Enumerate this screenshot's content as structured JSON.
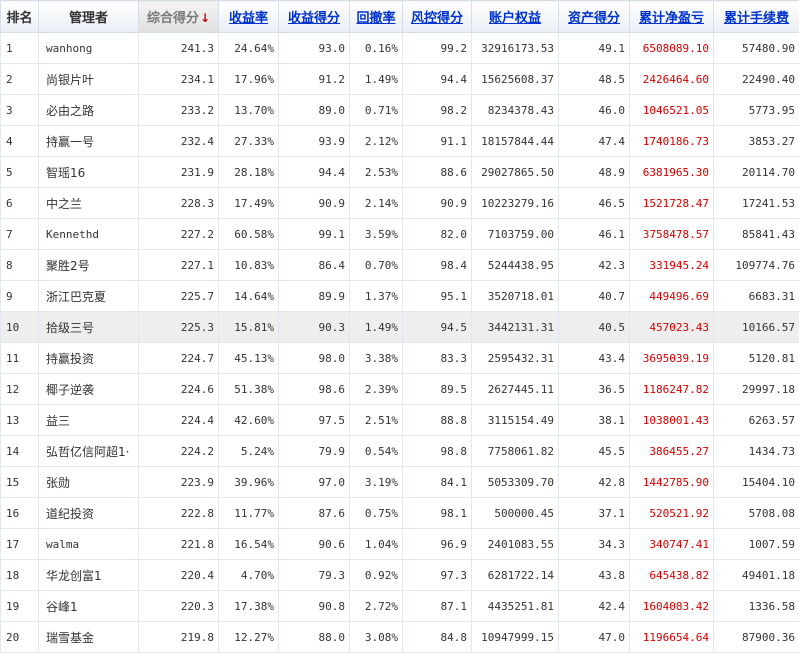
{
  "columns": {
    "rank": "排名",
    "manager": "管理者",
    "total_score": "综合得分",
    "total_score_sort": "↓",
    "return_rate": "收益率",
    "return_score": "收益得分",
    "drawdown": "回撤率",
    "risk_score": "风控得分",
    "equity": "账户权益",
    "asset_score": "资产得分",
    "cum_pnl": "累计净盈亏",
    "cum_fee": "累计手续费"
  },
  "highlighted_row": 10,
  "rows": [
    {
      "rank": "1",
      "manager": "wanhong",
      "total_score": "241.3",
      "return_rate": "24.64%",
      "return_score": "93.0",
      "drawdown": "0.16%",
      "risk_score": "99.2",
      "equity": "32916173.53",
      "asset_score": "49.1",
      "cum_pnl": "6508089.10",
      "cum_fee": "57480.90"
    },
    {
      "rank": "2",
      "manager": "尚银片叶",
      "total_score": "234.1",
      "return_rate": "17.96%",
      "return_score": "91.2",
      "drawdown": "1.49%",
      "risk_score": "94.4",
      "equity": "15625608.37",
      "asset_score": "48.5",
      "cum_pnl": "2426464.60",
      "cum_fee": "22490.40"
    },
    {
      "rank": "3",
      "manager": "必由之路",
      "total_score": "233.2",
      "return_rate": "13.70%",
      "return_score": "89.0",
      "drawdown": "0.71%",
      "risk_score": "98.2",
      "equity": "8234378.43",
      "asset_score": "46.0",
      "cum_pnl": "1046521.05",
      "cum_fee": "5773.95"
    },
    {
      "rank": "4",
      "manager": "持赢一号",
      "total_score": "232.4",
      "return_rate": "27.33%",
      "return_score": "93.9",
      "drawdown": "2.12%",
      "risk_score": "91.1",
      "equity": "18157844.44",
      "asset_score": "47.4",
      "cum_pnl": "1740186.73",
      "cum_fee": "3853.27"
    },
    {
      "rank": "5",
      "manager": "智瑶16",
      "total_score": "231.9",
      "return_rate": "28.18%",
      "return_score": "94.4",
      "drawdown": "2.53%",
      "risk_score": "88.6",
      "equity": "29027865.50",
      "asset_score": "48.9",
      "cum_pnl": "6381965.30",
      "cum_fee": "20114.70"
    },
    {
      "rank": "6",
      "manager": "中之兰",
      "total_score": "228.3",
      "return_rate": "17.49%",
      "return_score": "90.9",
      "drawdown": "2.14%",
      "risk_score": "90.9",
      "equity": "10223279.16",
      "asset_score": "46.5",
      "cum_pnl": "1521728.47",
      "cum_fee": "17241.53"
    },
    {
      "rank": "7",
      "manager": "Kennethd",
      "total_score": "227.2",
      "return_rate": "60.58%",
      "return_score": "99.1",
      "drawdown": "3.59%",
      "risk_score": "82.0",
      "equity": "7103759.00",
      "asset_score": "46.1",
      "cum_pnl": "3758478.57",
      "cum_fee": "85841.43"
    },
    {
      "rank": "8",
      "manager": "聚胜2号",
      "total_score": "227.1",
      "return_rate": "10.83%",
      "return_score": "86.4",
      "drawdown": "0.70%",
      "risk_score": "98.4",
      "equity": "5244438.95",
      "asset_score": "42.3",
      "cum_pnl": "331945.24",
      "cum_fee": "109774.76"
    },
    {
      "rank": "9",
      "manager": "浙江巴克夏",
      "total_score": "225.7",
      "return_rate": "14.64%",
      "return_score": "89.9",
      "drawdown": "1.37%",
      "risk_score": "95.1",
      "equity": "3520718.01",
      "asset_score": "40.7",
      "cum_pnl": "449496.69",
      "cum_fee": "6683.31"
    },
    {
      "rank": "10",
      "manager": "拾级三号",
      "total_score": "225.3",
      "return_rate": "15.81%",
      "return_score": "90.3",
      "drawdown": "1.49%",
      "risk_score": "94.5",
      "equity": "3442131.31",
      "asset_score": "40.5",
      "cum_pnl": "457023.43",
      "cum_fee": "10166.57"
    },
    {
      "rank": "11",
      "manager": "持赢投资",
      "total_score": "224.7",
      "return_rate": "45.13%",
      "return_score": "98.0",
      "drawdown": "3.38%",
      "risk_score": "83.3",
      "equity": "2595432.31",
      "asset_score": "43.4",
      "cum_pnl": "3695039.19",
      "cum_fee": "5120.81"
    },
    {
      "rank": "12",
      "manager": "椰子逆袭",
      "total_score": "224.6",
      "return_rate": "51.38%",
      "return_score": "98.6",
      "drawdown": "2.39%",
      "risk_score": "89.5",
      "equity": "2627445.11",
      "asset_score": "36.5",
      "cum_pnl": "1186247.82",
      "cum_fee": "29997.18"
    },
    {
      "rank": "13",
      "manager": "益三",
      "total_score": "224.4",
      "return_rate": "42.60%",
      "return_score": "97.5",
      "drawdown": "2.51%",
      "risk_score": "88.8",
      "equity": "3115154.49",
      "asset_score": "38.1",
      "cum_pnl": "1038001.43",
      "cum_fee": "6263.57"
    },
    {
      "rank": "14",
      "manager": "弘哲亿信阿超1·",
      "total_score": "224.2",
      "return_rate": "5.24%",
      "return_score": "79.9",
      "drawdown": "0.54%",
      "risk_score": "98.8",
      "equity": "7758061.82",
      "asset_score": "45.5",
      "cum_pnl": "386455.27",
      "cum_fee": "1434.73"
    },
    {
      "rank": "15",
      "manager": "张勋",
      "total_score": "223.9",
      "return_rate": "39.96%",
      "return_score": "97.0",
      "drawdown": "3.19%",
      "risk_score": "84.1",
      "equity": "5053309.70",
      "asset_score": "42.8",
      "cum_pnl": "1442785.90",
      "cum_fee": "15404.10"
    },
    {
      "rank": "16",
      "manager": "道纪投资",
      "total_score": "222.8",
      "return_rate": "11.77%",
      "return_score": "87.6",
      "drawdown": "0.75%",
      "risk_score": "98.1",
      "equity": "500000.45",
      "asset_score": "37.1",
      "cum_pnl": "520521.92",
      "cum_fee": "5708.08"
    },
    {
      "rank": "17",
      "manager": "walma",
      "total_score": "221.8",
      "return_rate": "16.54%",
      "return_score": "90.6",
      "drawdown": "1.04%",
      "risk_score": "96.9",
      "equity": "2401083.55",
      "asset_score": "34.3",
      "cum_pnl": "340747.41",
      "cum_fee": "1007.59"
    },
    {
      "rank": "18",
      "manager": "华龙创富1",
      "total_score": "220.4",
      "return_rate": "4.70%",
      "return_score": "79.3",
      "drawdown": "0.92%",
      "risk_score": "97.3",
      "equity": "6281722.14",
      "asset_score": "43.8",
      "cum_pnl": "645438.82",
      "cum_fee": "49401.18"
    },
    {
      "rank": "19",
      "manager": "谷峰1",
      "total_score": "220.3",
      "return_rate": "17.38%",
      "return_score": "90.8",
      "drawdown": "2.72%",
      "risk_score": "87.1",
      "equity": "4435251.81",
      "asset_score": "42.4",
      "cum_pnl": "1604083.42",
      "cum_fee": "1336.58"
    },
    {
      "rank": "20",
      "manager": "瑞雪基金",
      "total_score": "219.8",
      "return_rate": "12.27%",
      "return_score": "88.0",
      "drawdown": "3.08%",
      "risk_score": "84.8",
      "equity": "10947999.15",
      "asset_score": "47.0",
      "cum_pnl": "1196654.64",
      "cum_fee": "87900.36"
    }
  ]
}
